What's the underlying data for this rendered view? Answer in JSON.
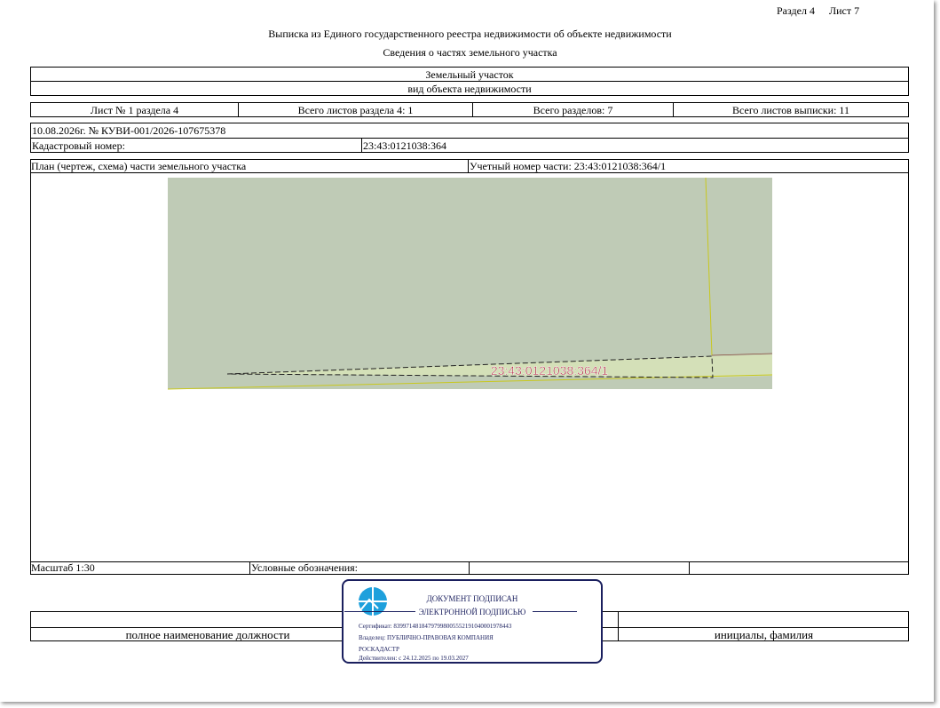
{
  "header": {
    "section": "Раздел 4",
    "sheet": "Лист 7",
    "title": "Выписка из Единого государственного реестра недвижимости об объекте недвижимости",
    "subtitle": "Сведения о частях земельного участка"
  },
  "object": {
    "type": "Земельный участок",
    "type_caption": "вид объекта недвижимости"
  },
  "sheets_row": {
    "sheet_of_section": "Лист № 1 раздела 4",
    "total_section_sheets": "Всего листов раздела 4: 1",
    "total_sections": "Всего разделов: 7",
    "total_extract_sheets": "Всего листов выписки: 11"
  },
  "doc_ref": "10.08.2026г. № КУВИ-001/2026-107675378",
  "cadastral": {
    "label": "Кадастровый номер:",
    "value": "23:43:0121038:364"
  },
  "plan": {
    "label": "План (чертеж, схема) части земельного участка",
    "part_number_label": "Учетный номер части: 23:43:0121038:364/1",
    "map_label": "23:43:0121038:364/1",
    "scale": "Масштаб 1:30",
    "legend_label": "Условные обозначения:"
  },
  "footer": {
    "position_caption": "полное наименование должности",
    "name_caption": "инициалы, фамилия"
  },
  "stamp": {
    "line1": "ДОКУМЕНТ ПОДПИСАН",
    "line2": "ЭЛЕКТРОННОЙ ПОДПИСЬЮ",
    "certificate": "Сертификат: 83997148184797998005552191040001978443",
    "owner": "Владелец: ПУБЛИЧНО-ПРАВОВАЯ КОМПАНИЯ",
    "owner2": "РОСКАДАСТР",
    "valid": "Действителен: с 24.12.2025 по 19.03.2027",
    "color": "#1a1f5e"
  },
  "colors": {
    "map_fill": "#bfcbb6",
    "strip_fill": "#d4e0b8",
    "label_color": "#b0263e",
    "boundary": "#c8c81e"
  }
}
